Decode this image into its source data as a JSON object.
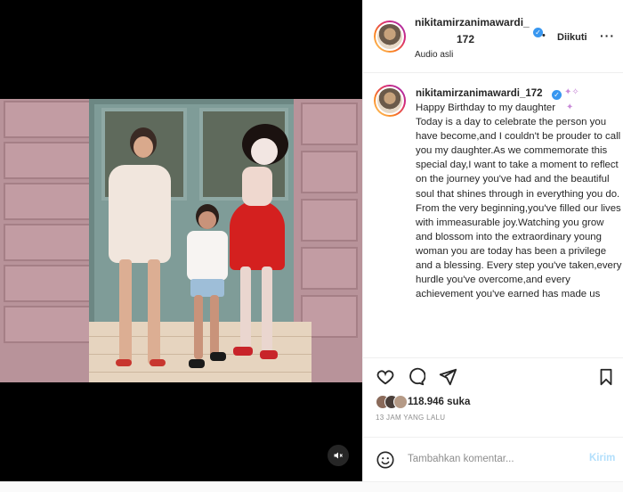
{
  "post": {
    "username": "nikitamirzanimawardi_172",
    "username_line1": "nikitamirzanimawardi_",
    "username_line2": "172",
    "follow_label": "Diikuti",
    "dot": "•",
    "more_label": "···",
    "audio_label": "Audio asli"
  },
  "caption": {
    "username": "nikitamirzanimawardi_172",
    "text": "Happy Birthday to my daughter\nToday is a day to celebrate the person you have become,and I couldn't be proude​r to call you my daughter.As we commemorate this special day,I want to take a moment to reflect on the journey you've had and the beautiful soul that shines through in everything you do.\nFrom the very beginning,you've filled our lives with immeasurable joy.Watching you grow and blossom into the extraordinary young woman you are today has been a privilege and a blessing. Every step you've taken,every hurdle you've overcome,and every achievement you've earned has made us"
  },
  "engagement": {
    "likes": "118.946 suka",
    "time": "13 JAM YANG LALU"
  },
  "comment": {
    "placeholder": "Tambahkan komentar...",
    "post_label": "Kirim"
  },
  "icons": {
    "verified": "verified-badge-icon",
    "like": "heart-icon",
    "comment": "comment-bubble-icon",
    "share": "paper-plane-icon",
    "save": "bookmark-icon",
    "emoji": "smiley-icon",
    "mute": "speaker-muted-icon",
    "sparkle": "sparkles-emoji-icon"
  },
  "colors": {
    "verified": "#3897f0",
    "post_disabled": "#b2dffc",
    "muted_text": "#8e8e8e"
  }
}
